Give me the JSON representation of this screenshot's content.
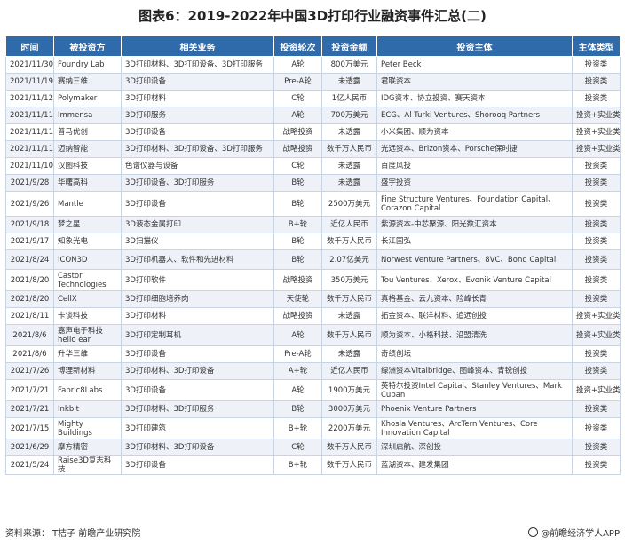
{
  "title": "图表6：2019-2022年中国3D打印行业融资事件汇总(二)",
  "columns": [
    "时间",
    "被投资方",
    "相关业务",
    "投资轮次",
    "投资金额",
    "投资主体",
    "主体类型"
  ],
  "rows": [
    [
      "2021/11/30",
      "Foundry Lab",
      "3D打印材料、3D打印设备、3D打印服务",
      "A轮",
      "800万美元",
      "Peter Beck",
      "投资类"
    ],
    [
      "2021/11/19",
      "赛纳三维",
      "3D打印设备",
      "Pre-A轮",
      "未透露",
      "君联资本",
      "投资类"
    ],
    [
      "2021/11/12",
      "Polymaker",
      "3D打印材料",
      "C轮",
      "1亿人民币",
      "IDG资本、协立投资、赛天资本",
      "投资类"
    ],
    [
      "2021/11/11",
      "Immensa",
      "3D打印服务",
      "A轮",
      "700万美元",
      "ECG、Al Turki Ventures、Shorooq Partners",
      "投资+实业类"
    ],
    [
      "2021/11/11",
      "普马优创",
      "3D打印设备",
      "战略投资",
      "未透露",
      "小米集团、顺为资本",
      "投资+实业类"
    ],
    [
      "2021/11/11",
      "迈纳智能",
      "3D打印材料、3D打印设备、3D打印服务",
      "战略投资",
      "数千万人民币",
      "光远资本、Brizon资本、Porsche保时捷",
      "投资+实业类"
    ],
    [
      "2021/11/10",
      "汉图科技",
      "色谱仪器与设备",
      "C轮",
      "未透露",
      "百度风投",
      "投资类"
    ],
    [
      "2021/9/28",
      "华曙高科",
      "3D打印设备、3D打印服务",
      "B轮",
      "未透露",
      "盛宇投资",
      "投资类"
    ],
    [
      "2021/9/26",
      "Mantle",
      "3D打印设备",
      "B轮",
      "2500万美元",
      "Fine Structure Ventures、Foundation Capital、Corazon Capital",
      "投资类"
    ],
    [
      "2021/9/18",
      "梦之星",
      "3D液态金属打印",
      "B+轮",
      "近亿人民币",
      "紫源资本-中芯聚源、阳光数汇资本",
      "投资类"
    ],
    [
      "2021/9/17",
      "知象光电",
      "3D扫描仪",
      "B轮",
      "数千万人民币",
      "长江国弘",
      "投资类"
    ],
    [
      "2021/8/24",
      "ICON3D",
      "3D打印机器人、软件和先进材料",
      "B轮",
      "2.07亿美元",
      "Norwest Venture Partners、8VC、Bond Capital",
      "投资类"
    ],
    [
      "2021/8/20",
      "Castor Technologies",
      "3D打印软件",
      "战略投资",
      "350万美元",
      "Tou Ventures、Xerox、Evonik Venture Capital",
      "投资类"
    ],
    [
      "2021/8/20",
      "CellX",
      "3D打印细胞培养肉",
      "天使轮",
      "数千万人民币",
      "真格基金、云九资本、险峰长青",
      "投资类"
    ],
    [
      "2021/8/11",
      "卡谈科技",
      "3D打印材料",
      "战略投资",
      "未透露",
      "拓金资本、联洋材料、追远创投",
      "投资+实业类"
    ],
    [
      "2021/8/6",
      "嘉声电子科技 hello ear",
      "3D打印定制耳机",
      "A轮",
      "数千万人民币",
      "顺为资本、小格科技、沿盟清洗",
      "投资+实业类"
    ],
    [
      "2021/8/6",
      "升华三维",
      "3D打印设备",
      "Pre-A轮",
      "未透露",
      "奇绩创坛",
      "投资类"
    ],
    [
      "2021/7/26",
      "博理新材料",
      "3D打印材料、3D打印设备",
      "A+轮",
      "近亿人民币",
      "绿洲资本Vitalbridge、图峰资本、青锐创投",
      "投资类"
    ],
    [
      "2021/7/21",
      "Fabric8Labs",
      "3D打印设备",
      "A轮",
      "1900万美元",
      "英特尔投资Intel Capital、Stanley Ventures、Mark Cuban",
      "投资+实业类"
    ],
    [
      "2021/7/21",
      "Inkbit",
      "3D打印材料、3D打印服务",
      "B轮",
      "3000万美元",
      "Phoenix Venture Partners",
      "投资类"
    ],
    [
      "2021/7/15",
      "Mighty Buildings",
      "3D打印建筑",
      "B+轮",
      "2200万美元",
      "Khosla Ventures、ArcTern Ventures、Core Innovation Capital",
      "投资类"
    ],
    [
      "2021/6/29",
      "摩方精密",
      "3D打印材料、3D打印设备",
      "C轮",
      "数千万人民币",
      "深圳启航、深创投",
      "投资类"
    ],
    [
      "2021/5/24",
      "Raise3D复志科技",
      "3D打印设备",
      "B+轮",
      "数千万人民币",
      "蓝湖资本、建发集团",
      "投资类"
    ]
  ],
  "footer": {
    "source": "资料来源：IT桔子 前瞻产业研究院",
    "brand": "@前瞻经济学人APP"
  }
}
